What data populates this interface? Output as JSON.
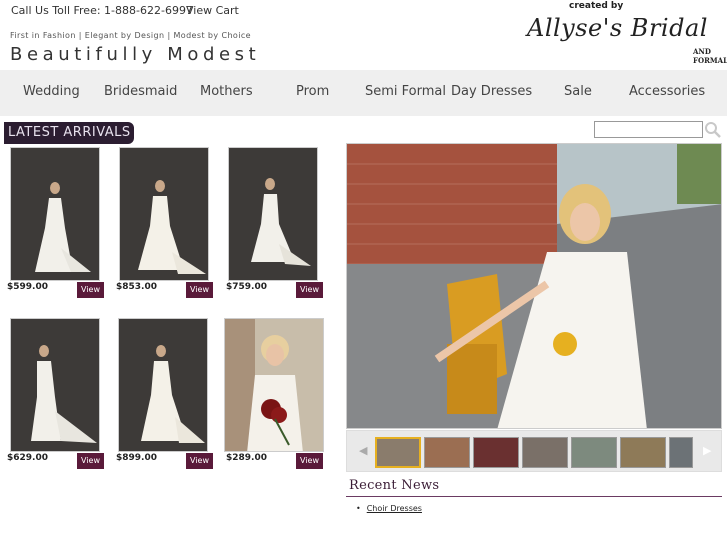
{
  "header": {
    "toll_free": "Call Us Toll Free: 1-888-622-6997",
    "view_cart": "View Cart",
    "tagline": "First in Fashion | Elegant by Design | Modest by Choice",
    "slogan": "Beautifully Modest",
    "logo": {
      "created_by": "created by",
      "brand": "Allyse's Bridal",
      "formal": "AND FORMAL"
    }
  },
  "nav": {
    "items": [
      "Wedding",
      "Bridesmaid",
      "Mothers",
      "Prom",
      "Semi Formal",
      "Day Dresses",
      "Sale",
      "Accessories"
    ]
  },
  "latest": {
    "heading": "LATEST ARRIVALS",
    "products": [
      {
        "price": "$599.00",
        "view_label": "View"
      },
      {
        "price": "$853.00",
        "view_label": "View"
      },
      {
        "price": "$759.00",
        "view_label": "View"
      },
      {
        "price": "$629.00",
        "view_label": "View"
      },
      {
        "price": "$899.00",
        "view_label": "View"
      },
      {
        "price": "$289.00",
        "view_label": "View"
      }
    ]
  },
  "search": {
    "placeholder": "",
    "value": ""
  },
  "slideshow": {
    "prev_arrow": "◀",
    "next_arrow": "▶"
  },
  "news": {
    "heading": "Recent News",
    "items": [
      "Choir Dresses"
    ]
  },
  "colors": {
    "accent": "#5a1a3a",
    "heading_bg": "#2b1d31",
    "nav_bg": "#efefef"
  }
}
